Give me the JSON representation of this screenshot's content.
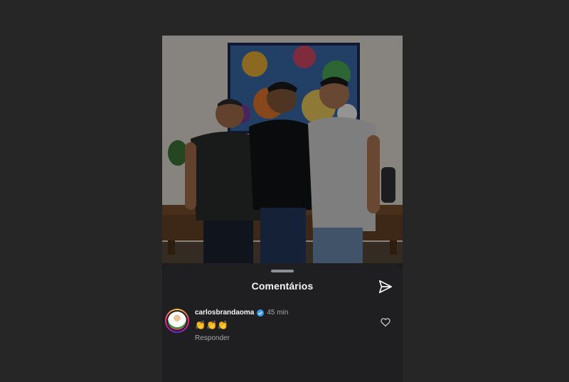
{
  "sheet": {
    "title": "Comentários"
  },
  "comments": [
    {
      "username": "carlosbrandaoma",
      "verified": true,
      "time": "45 min",
      "text": "👏👏👏",
      "reply_label": "Responder"
    }
  ],
  "icons": {
    "share": "paper-plane-icon",
    "like": "heart-outline-icon",
    "verified": "verified-badge-icon"
  },
  "colors": {
    "page_background": "#262626",
    "sheet_background": "#1f1f21",
    "verified_blue": "#3897f0",
    "muted_text": "#a8a8a8"
  }
}
